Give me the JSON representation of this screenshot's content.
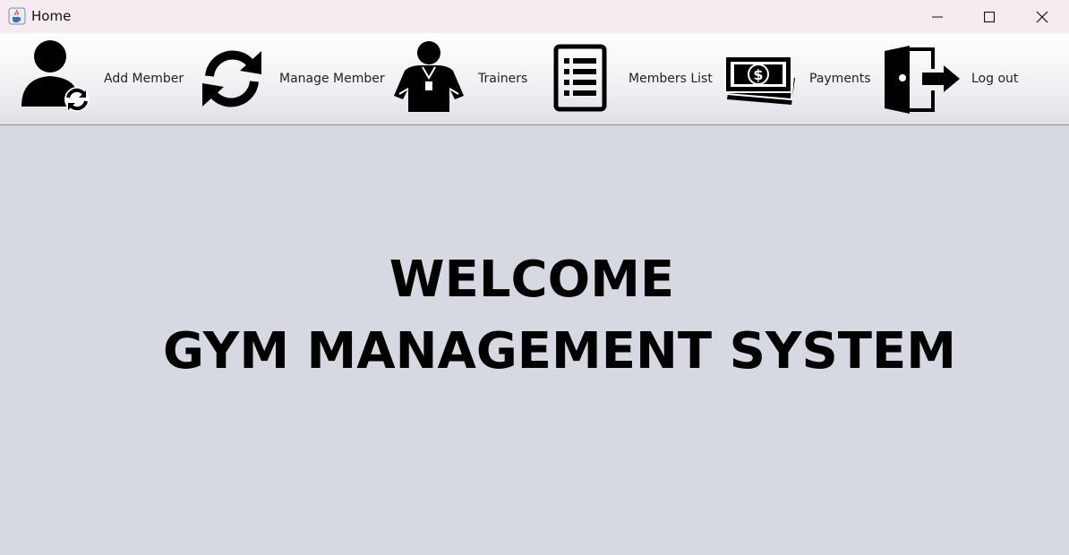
{
  "window": {
    "title": "Home",
    "app_icon": "java-cup-icon",
    "controls": [
      "minimize-icon",
      "maximize-icon",
      "close-icon"
    ]
  },
  "toolbar": {
    "items": [
      {
        "label": "Add Member",
        "icon": "user-refresh-icon"
      },
      {
        "label": "Manage Member",
        "icon": "refresh-icon"
      },
      {
        "label": "Trainers",
        "icon": "trainer-icon"
      },
      {
        "label": "Members List",
        "icon": "list-icon"
      },
      {
        "label": "Payments",
        "icon": "money-icon"
      },
      {
        "label": "Log out",
        "icon": "logout-door-icon"
      }
    ]
  },
  "main": {
    "welcome_line1": "WELCOME",
    "welcome_line2": "GYM MANAGEMENT SYSTEM"
  },
  "colors": {
    "background": "#d6d9e1",
    "titlebar": "#f5ecf2",
    "text": "#000000"
  }
}
